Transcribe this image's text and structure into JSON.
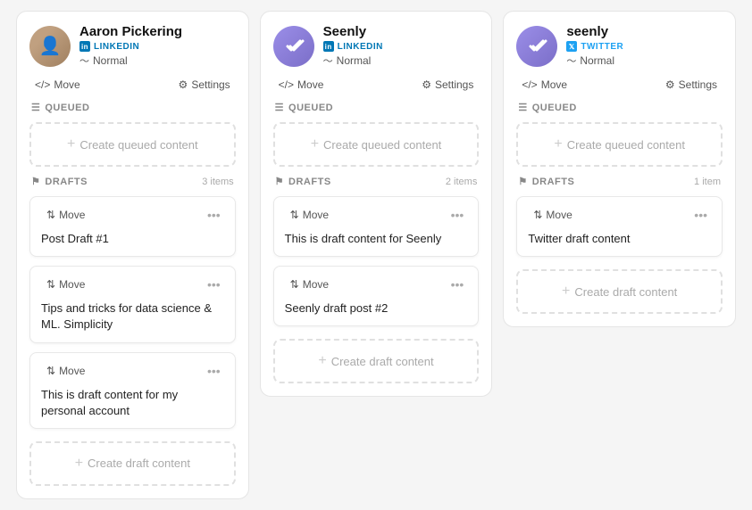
{
  "columns": [
    {
      "id": "aaron",
      "profile_name": "Aaron Pickering",
      "social_platform": "LINKEDIN",
      "social_type": "linkedin",
      "status": "Normal",
      "move_label": "Move",
      "settings_label": "Settings",
      "queued_label": "QUEUED",
      "queued_create": "Create queued content",
      "drafts_label": "DRAFTS",
      "drafts_count": "3 items",
      "drafts": [
        {
          "id": "d1",
          "content": "Post Draft #1"
        },
        {
          "id": "d2",
          "content": "Tips and tricks for data science & ML. Simplicity"
        },
        {
          "id": "d3",
          "content": "This is draft content for my personal account"
        }
      ],
      "create_draft_label": "Create draft content"
    },
    {
      "id": "seenly-linkedin",
      "profile_name": "Seenly",
      "social_platform": "LINKEDIN",
      "social_type": "linkedin",
      "status": "Normal",
      "move_label": "Move",
      "settings_label": "Settings",
      "queued_label": "QUEUED",
      "queued_create": "Create queued content",
      "drafts_label": "DRAFTS",
      "drafts_count": "2 items",
      "drafts": [
        {
          "id": "d4",
          "content": "This is draft content for Seenly"
        },
        {
          "id": "d5",
          "content": "Seenly draft post #2"
        }
      ],
      "create_draft_label": "Create draft content"
    },
    {
      "id": "seenly-twitter",
      "profile_name": "seenly",
      "social_platform": "TWITTER",
      "social_type": "twitter",
      "status": "Normal",
      "move_label": "Move",
      "settings_label": "Settings",
      "queued_label": "QUEUED",
      "queued_create": "Create queued content",
      "drafts_label": "DRAFTS",
      "drafts_count": "1 item",
      "drafts": [
        {
          "id": "d6",
          "content": "Twitter draft content"
        }
      ],
      "create_draft_label": "Create draft content"
    }
  ],
  "icons": {
    "move": "⇅",
    "settings": "⚙",
    "queued": "☰",
    "drafts": "⚑",
    "dots": "•••",
    "plus": "+",
    "wave": "〜"
  }
}
